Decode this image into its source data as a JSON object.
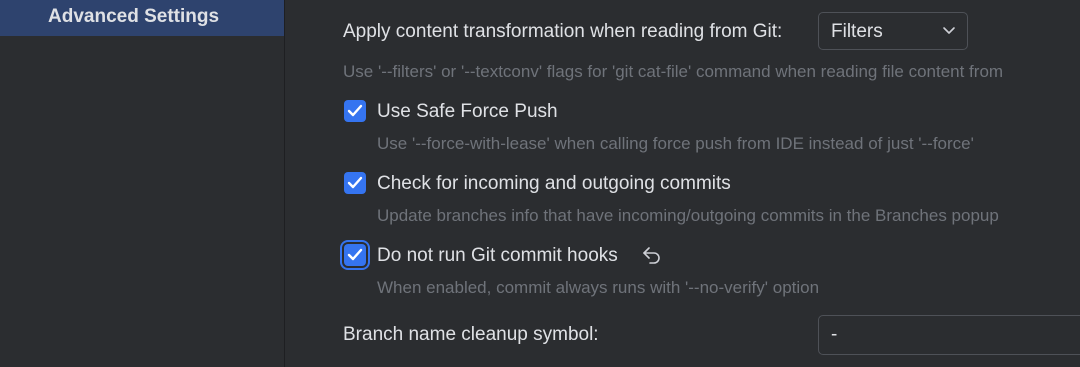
{
  "sidebar": {
    "selected_item": "Advanced Settings"
  },
  "settings": {
    "content_transformation": {
      "label": "Apply content transformation when reading from Git:",
      "value": "Filters",
      "hint": "Use '--filters' or '--textconv' flags for 'git cat-file' command when reading file content from"
    },
    "safe_force_push": {
      "label": "Use Safe Force Push",
      "checked": true,
      "hint": "Use '--force-with-lease' when calling force push from IDE instead of just '--force'"
    },
    "incoming_outgoing": {
      "label": "Check for incoming and outgoing commits",
      "checked": true,
      "hint": "Update branches info that have incoming/outgoing commits in the Branches popup"
    },
    "commit_hooks": {
      "label": "Do not run Git commit hooks",
      "checked": true,
      "hint": "When enabled, commit always runs with '--no-verify' option"
    },
    "branch_cleanup": {
      "label": "Branch name cleanup symbol:",
      "value": "-"
    }
  },
  "icons": {
    "dropdown": "chevron-down-icon",
    "check": "check-icon",
    "reset": "undo-icon"
  },
  "colors": {
    "background": "#2b2d30",
    "selection": "#2e436e",
    "accent": "#3574f0",
    "text": "#dfe1e5",
    "hint": "#6f737a"
  }
}
